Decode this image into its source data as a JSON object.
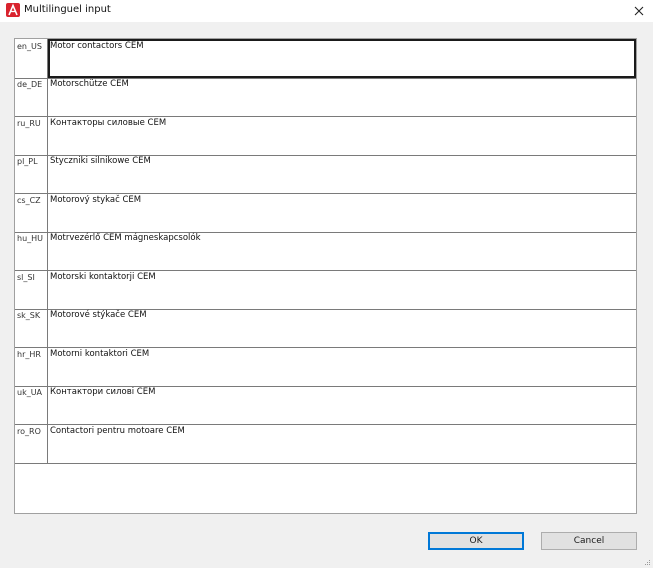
{
  "window": {
    "title": "Multilinguel input"
  },
  "rows": [
    {
      "lang": "en_US",
      "text": "Motor contactors CEM"
    },
    {
      "lang": "de_DE",
      "text": "Motorschütze CEM"
    },
    {
      "lang": "ru_RU",
      "text": "Контакторы силовые CEM"
    },
    {
      "lang": "pl_PL",
      "text": "Styczniki silnikowe CEM"
    },
    {
      "lang": "cs_CZ",
      "text": "Motorový stykač CEM"
    },
    {
      "lang": "hu_HU",
      "text": "Motrvezérlő CEM mágneskapcsolók"
    },
    {
      "lang": "sl_SI",
      "text": "Motorski kontaktorji CEM"
    },
    {
      "lang": "sk_SK",
      "text": "Motorové stýkače CEM"
    },
    {
      "lang": "hr_HR",
      "text": "Motorni kontaktori CEM"
    },
    {
      "lang": "uk_UA",
      "text": "Контактори силові CEM"
    },
    {
      "lang": "ro_RO",
      "text": "Contactori pentru motoare CEM"
    }
  ],
  "buttons": {
    "ok": "OK",
    "cancel": "Cancel"
  },
  "icons": {
    "app": "app-logo-icon",
    "close": "close-icon"
  }
}
